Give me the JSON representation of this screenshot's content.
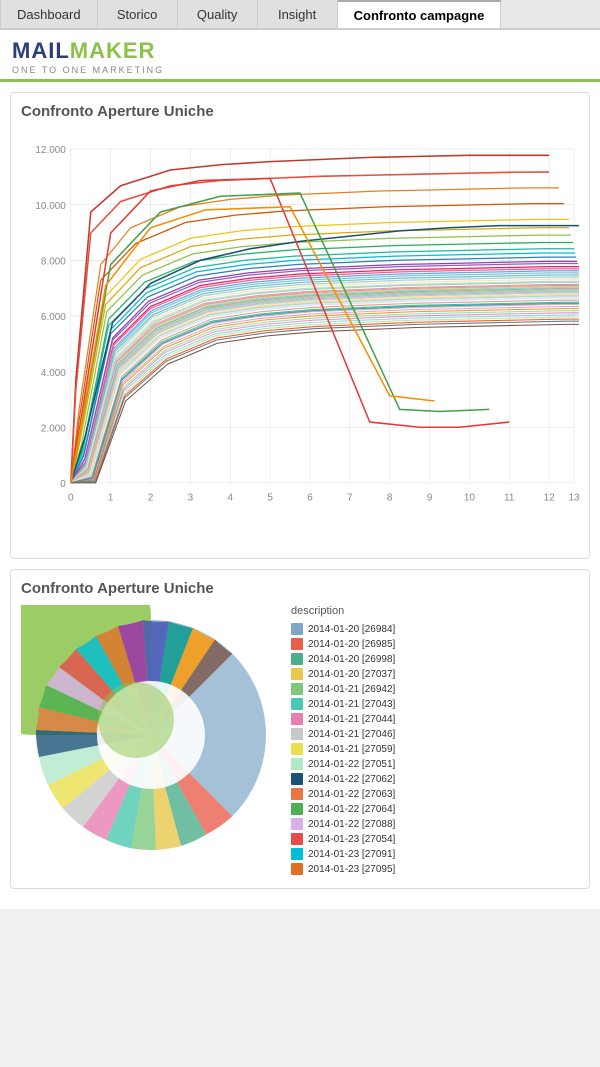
{
  "tabs": [
    {
      "label": "Dashboard",
      "active": false
    },
    {
      "label": "Storico",
      "active": false
    },
    {
      "label": "Quality",
      "active": false
    },
    {
      "label": "Insight",
      "active": false
    },
    {
      "label": "Confronto campagne",
      "active": true
    }
  ],
  "logo": {
    "mail": "MAIL",
    "maker": "MAKER",
    "tagline": "ONE TO ONE MARKETING"
  },
  "lineChart": {
    "title": "Confronto Aperture Uniche",
    "yAxis": [
      "12.000",
      "10.000",
      "8.000",
      "6.000",
      "4.000",
      "2.000",
      "0"
    ],
    "xAxis": [
      "0",
      "1",
      "2",
      "3",
      "4",
      "5",
      "6",
      "7",
      "8",
      "9",
      "10",
      "11",
      "12",
      "13"
    ]
  },
  "pieChart": {
    "title": "Confronto Aperture Uniche",
    "legendTitle": "description"
  },
  "legend": [
    {
      "color": "#7ea6c8",
      "label": "2014-01-20 [26984]"
    },
    {
      "color": "#e8604c",
      "label": "2014-01-20 [26985]"
    },
    {
      "color": "#4caf8c",
      "label": "2014-01-20 [26998]"
    },
    {
      "color": "#e8c84c",
      "label": "2014-01-20 [27037]"
    },
    {
      "color": "#7ec87e",
      "label": "2014-01-21 [26942]"
    },
    {
      "color": "#4cc8b0",
      "label": "2014-01-21 [27043]"
    },
    {
      "color": "#e87eb0",
      "label": "2014-01-21 [27044]"
    },
    {
      "color": "#c8c8c8",
      "label": "2014-01-21 [27046]"
    },
    {
      "color": "#e8e04c",
      "label": "2014-01-21 [27059]"
    },
    {
      "color": "#b0e8c8",
      "label": "2014-01-22 [27051]"
    },
    {
      "color": "#1a5276",
      "label": "2014-01-22 [27062]"
    },
    {
      "color": "#e87840",
      "label": "2014-01-22 [27063]"
    },
    {
      "color": "#4caf50",
      "label": "2014-01-22 [27064]"
    },
    {
      "color": "#d8b0e8",
      "label": "2014-01-22 [27088]"
    },
    {
      "color": "#e84c4c",
      "label": "2014-01-23 [27054]"
    },
    {
      "color": "#00bcd4",
      "label": "2014-01-23 [27091]"
    },
    {
      "color": "#e07028",
      "label": "2014-01-23 [27095]"
    }
  ]
}
